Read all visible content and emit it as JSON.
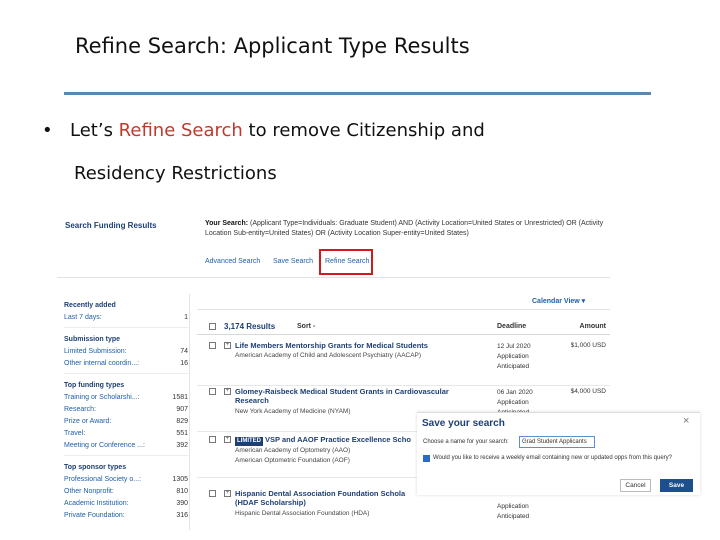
{
  "slide": {
    "title": "Refine Search: Applicant Type Results",
    "bullet_prefix": "Let’s ",
    "bullet_highlight": "Refine Search",
    "bullet_suffix": " to remove Citizenship and",
    "bullet_line2": "Residency Restrictions",
    "colors": {
      "rule": "#5b87b3",
      "highlight": "#c0392b",
      "callout_box": "#d11b1b"
    }
  },
  "header": {
    "title": "Search Funding Results",
    "your_search_label": "Your Search:",
    "your_search_text": "(Applicant Type=Individuals: Graduate Student) AND (Activity Location=United States or Unrestricted) OR (Activity Location Sub-entity=United States) OR (Activity Location Super-entity=United States)",
    "links": [
      "Advanced Search",
      "Save Search",
      "Refine Search"
    ]
  },
  "sidebar": {
    "sections": [
      {
        "heading": "Recently added",
        "items": [
          {
            "label": "Last 7 days:",
            "count": "1"
          }
        ]
      },
      {
        "heading": "Submission type",
        "items": [
          {
            "label": "Limited Submission:",
            "count": "74"
          },
          {
            "label": "Other internal coordin...:",
            "count": "16"
          }
        ]
      },
      {
        "heading": "Top funding types",
        "items": [
          {
            "label": "Training or Scholarshi...:",
            "count": "1581"
          },
          {
            "label": "Research:",
            "count": "907"
          },
          {
            "label": "Prize or Award:",
            "count": "829"
          },
          {
            "label": "Travel:",
            "count": "551"
          },
          {
            "label": "Meeting or Conference ...:",
            "count": "392"
          }
        ]
      },
      {
        "heading": "Top sponsor types",
        "items": [
          {
            "label": "Professional Society o...:",
            "count": "1305"
          },
          {
            "label": "Other Nonprofit:",
            "count": "810"
          },
          {
            "label": "Academic Institution:",
            "count": "390"
          },
          {
            "label": "Private Foundation:",
            "count": "316"
          }
        ]
      }
    ]
  },
  "results": {
    "calendar_view": "Calendar View ▾",
    "count": "3,174 Results",
    "sort": "Sort -",
    "col_deadline": "Deadline",
    "col_amount": "Amount",
    "rows": [
      {
        "title": "Life Members Mentorship Grants for Medical Students",
        "badge": "",
        "sponsors": [
          "American Academy of Child and Adolescent Psychiatry (AACAP)"
        ],
        "deadline": [
          "12 Jul 2020",
          "Application",
          "Anticipated"
        ],
        "amount": "$1,000 USD"
      },
      {
        "title": "Glomey-Raisbeck Medical Student Grants in Cardiovascular Research",
        "badge": "",
        "sponsors": [
          "New York Academy of Medicine (NYAM)"
        ],
        "deadline": [
          "06 Jan 2020",
          "Application",
          "Anticipated"
        ],
        "amount": "$4,000 USD"
      },
      {
        "title": "VSP and AAOF Practice Excellence Scho",
        "badge": "LIMITED",
        "sponsors": [
          "American Academy of Optometry (AAO)",
          "American Optometric Foundation (AOF)"
        ],
        "deadline": [],
        "amount": ""
      },
      {
        "title": "Hispanic Dental Association Foundation Schola (HDAF Scholarship)",
        "badge": "",
        "sponsors": [
          "Hispanic Dental Association Foundation (HDA)"
        ],
        "deadline": [
          "Application",
          "Anticipated"
        ],
        "amount": ""
      }
    ]
  },
  "dialog": {
    "title": "Save your search",
    "close": "×",
    "name_label": "Choose a name for your search:",
    "name_value": "Grad Student Applicants",
    "email_label": "Would you like to receive a weekly email containing new or updated opps from this query?",
    "cancel": "Cancel",
    "save": "Save"
  }
}
